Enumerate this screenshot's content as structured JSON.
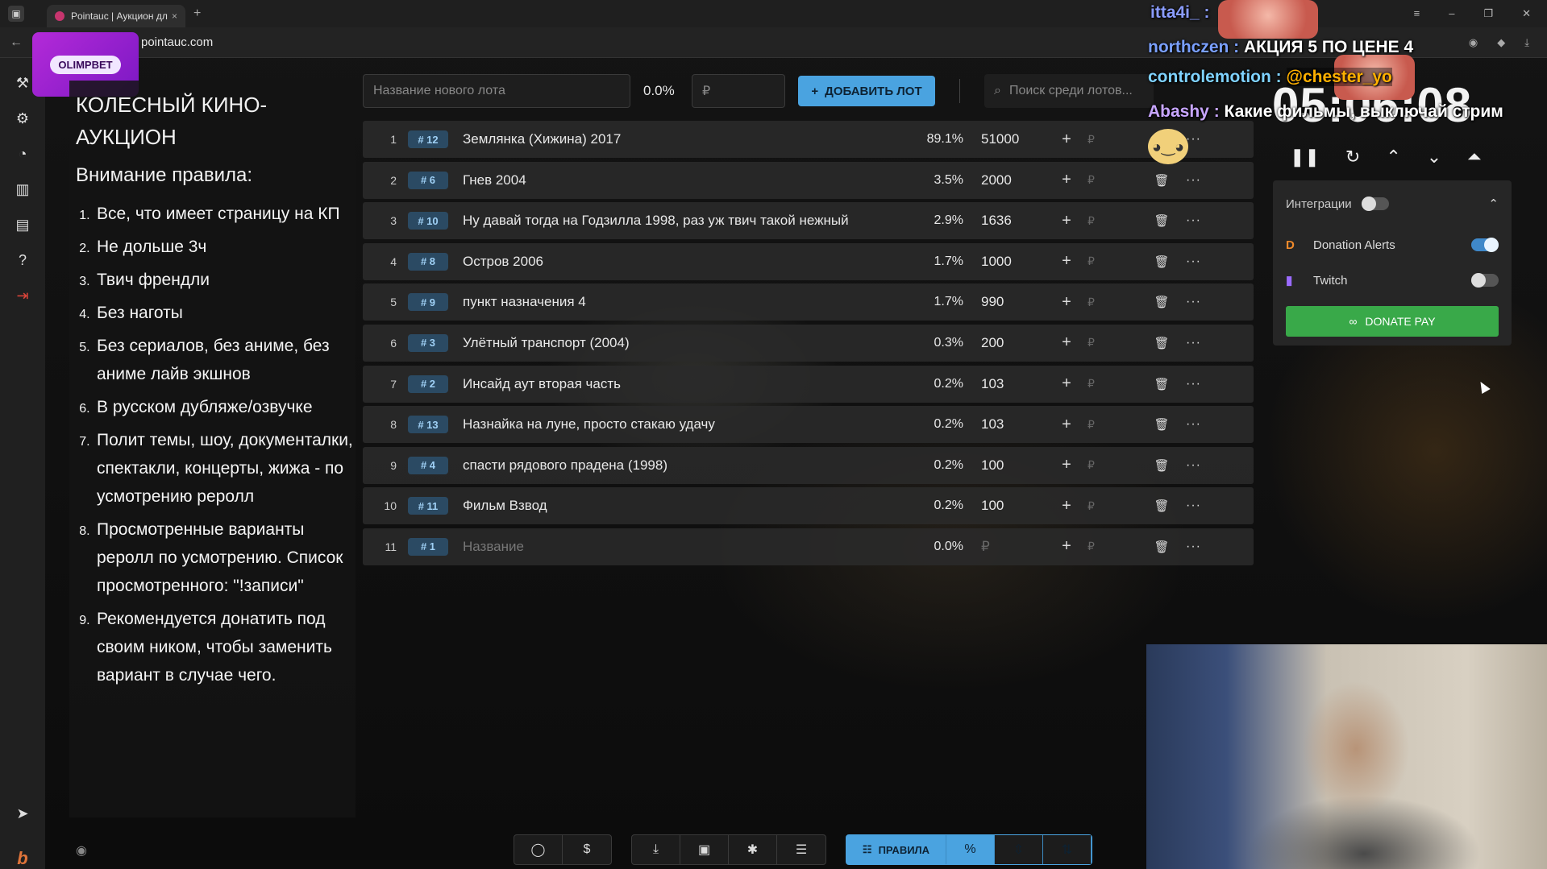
{
  "browser": {
    "tab_title": "Pointauc | Аукцион дл",
    "tab_close": "×",
    "new_tab": "+",
    "url": "pointauc.com",
    "win_min": "–",
    "win_max": "❐",
    "win_close": "✕"
  },
  "sponsor": {
    "label": "OLIMPBET"
  },
  "rules": {
    "title": "КОЛЕСНЫЙ КИНО-АУКЦИОН",
    "subtitle": "Внимание правила:",
    "items": [
      "Все, что имеет страницу на КП",
      "Не дольше 3ч",
      "Твич френдли",
      "Без наготы",
      "Без сериалов, без аниме, без аниме лайв экшнов",
      "В русском дубляже/озвучке",
      "Полит темы, шоу, документалки, спектакли, концерты, жижа - по усмотрению реролл",
      "Просмотренные варианты реролл по усмотрению. Список просмотренного: \"!записи\"",
      "Рекомендуется донатить под своим ником, чтобы заменить вариант в случае чего."
    ]
  },
  "topbar": {
    "lot_placeholder": "Название нового лота",
    "percent": "0.0%",
    "currency": "₽",
    "add_label": "ДОБАВИТЬ ЛОТ",
    "search_placeholder": "Поиск среди лотов..."
  },
  "lots": [
    {
      "idx": "1",
      "id": "# 12",
      "name": "Землянка (Хижина) 2017",
      "pct": "89.1%",
      "amount": "51000"
    },
    {
      "idx": "2",
      "id": "# 6",
      "name": "Гнев 2004",
      "pct": "3.5%",
      "amount": "2000"
    },
    {
      "idx": "3",
      "id": "# 10",
      "name": "Ну давай тогда на Годзилла 1998, раз уж твич такой нежный",
      "pct": "2.9%",
      "amount": "1636"
    },
    {
      "idx": "4",
      "id": "# 8",
      "name": "Остров 2006",
      "pct": "1.7%",
      "amount": "1000"
    },
    {
      "idx": "5",
      "id": "# 9",
      "name": "пункт назначения 4",
      "pct": "1.7%",
      "amount": "990"
    },
    {
      "idx": "6",
      "id": "# 3",
      "name": "Улётный транспорт (2004)",
      "pct": "0.3%",
      "amount": "200"
    },
    {
      "idx": "7",
      "id": "# 2",
      "name": "Инсайд аут вторая часть",
      "pct": "0.2%",
      "amount": "103"
    },
    {
      "idx": "8",
      "id": "# 13",
      "name": "Назнайка на луне, просто стакаю удачу",
      "pct": "0.2%",
      "amount": "103"
    },
    {
      "idx": "9",
      "id": "# 4",
      "name": "спасти рядового прадена (1998)",
      "pct": "0.2%",
      "amount": "100"
    },
    {
      "idx": "10",
      "id": "# 11",
      "name": "Фильм Взвод",
      "pct": "0.2%",
      "amount": "100"
    },
    {
      "idx": "11",
      "id": "# 1",
      "name": "Название",
      "pct": "0.0%",
      "amount": "₽"
    }
  ],
  "row_symbols": {
    "plus": "+",
    "currency": "₽",
    "trash": "🗑",
    "more": "···"
  },
  "timer": {
    "value": "05:06:08"
  },
  "integrations": {
    "title": "Интеграции",
    "enabled": false,
    "donation_alerts": {
      "label": "Donation Alerts",
      "enabled": true
    },
    "twitch": {
      "label": "Twitch",
      "enabled": false
    },
    "donate_pay": "DONATE PAY"
  },
  "chat": [
    {
      "user": "itta4i_ :",
      "text": ""
    },
    {
      "user": "northczen :",
      "text": "АКЦИЯ 5 ПО ЦЕНЕ 4"
    },
    {
      "user": "controlemotion :",
      "text": "@chester_yo"
    },
    {
      "user": "Abashy :",
      "text": "Какие фильмы, выключай стрим"
    }
  ],
  "bottom": {
    "rules_label": "ПРАВИЛА",
    "percent_label": "%"
  },
  "colors": {
    "accent": "#4aa3e0",
    "donate_green": "#39a949",
    "badge_bg": "#2b4a63"
  }
}
